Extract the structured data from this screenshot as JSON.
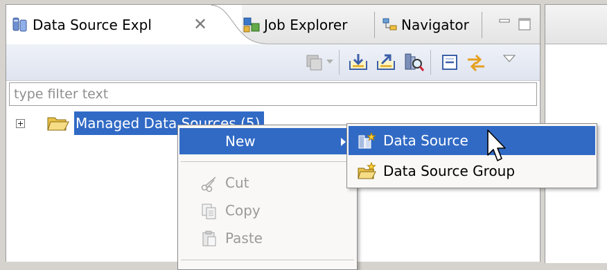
{
  "tabs": [
    {
      "label": "Data Source Expl",
      "icon": "data-source-explorer-icon",
      "active": true
    },
    {
      "label": "Job Explorer",
      "icon": "job-explorer-icon",
      "active": false
    },
    {
      "label": "Navigator",
      "icon": "navigator-icon",
      "active": false
    }
  ],
  "close_glyph": "✕",
  "filter": {
    "placeholder": "type filter text",
    "value": ""
  },
  "tree": {
    "items": [
      {
        "label": "Managed Data Sources (5)",
        "expanded": false,
        "selected": true,
        "icon": "folder-open-icon"
      }
    ]
  },
  "context_menu": {
    "items": [
      {
        "label": "New",
        "highlighted": true,
        "has_submenu": true
      },
      {
        "label": "Cut",
        "enabled": false,
        "icon": "scissors-icon"
      },
      {
        "label": "Copy",
        "enabled": false,
        "icon": "copy-icon"
      },
      {
        "label": "Paste",
        "enabled": false,
        "icon": "paste-icon"
      }
    ]
  },
  "submenu": {
    "items": [
      {
        "label": "Data Source",
        "highlighted": true,
        "icon": "new-data-source-icon"
      },
      {
        "label": "Data Source Group",
        "highlighted": false,
        "icon": "new-folder-icon"
      }
    ]
  },
  "colors": {
    "selection": "#316ac5",
    "background": "#d6d3ce",
    "disabled_text": "#9a9a9a"
  }
}
